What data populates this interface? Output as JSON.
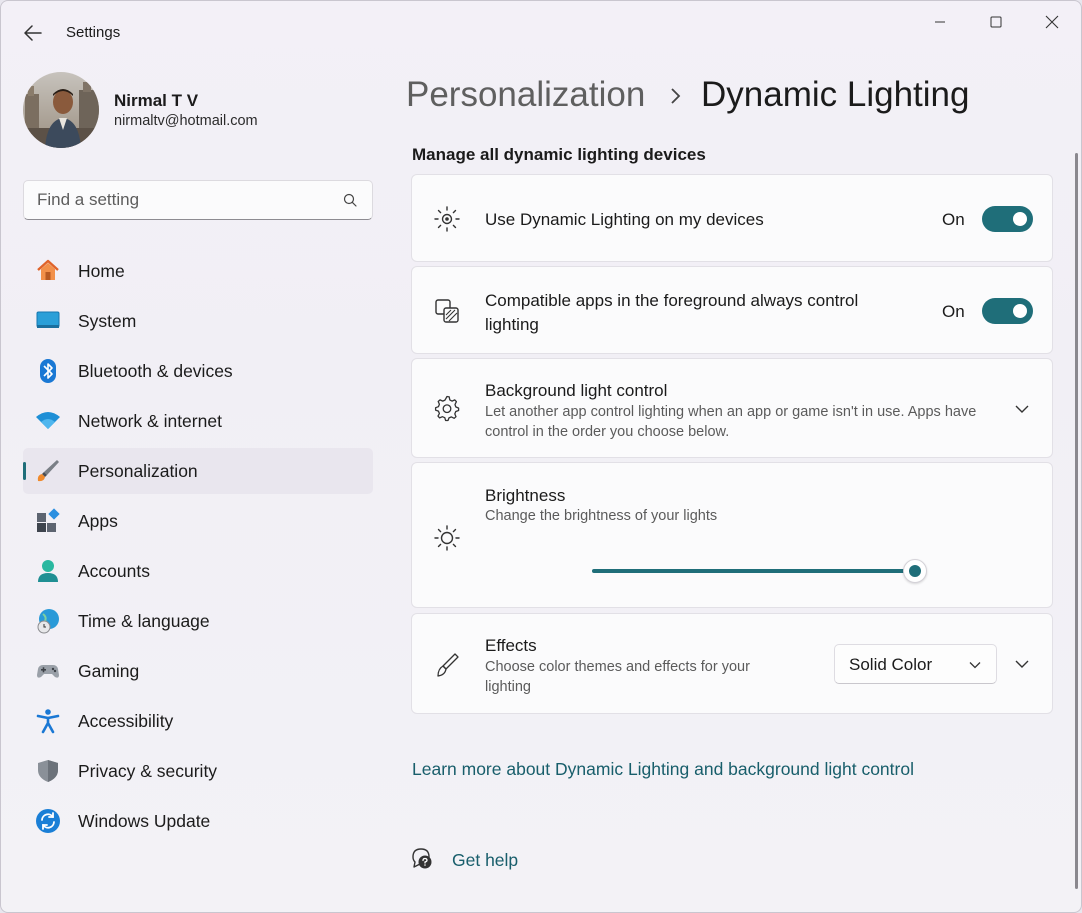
{
  "window": {
    "title": "Settings",
    "back_icon": "arrow-left-icon",
    "controls": [
      "minimize-icon",
      "maximize-icon",
      "close-icon"
    ]
  },
  "profile": {
    "name": "Nirmal T V",
    "email": "nirmaltv@hotmail.com"
  },
  "search": {
    "placeholder": "Find a setting",
    "value": ""
  },
  "sidebar": {
    "items": [
      {
        "label": "Home",
        "icon": "home-icon",
        "active": false
      },
      {
        "label": "System",
        "icon": "system-icon",
        "active": false
      },
      {
        "label": "Bluetooth & devices",
        "icon": "bluetooth-icon",
        "active": false
      },
      {
        "label": "Network & internet",
        "icon": "wifi-icon",
        "active": false
      },
      {
        "label": "Personalization",
        "icon": "paintbrush-icon",
        "active": true
      },
      {
        "label": "Apps",
        "icon": "apps-icon",
        "active": false
      },
      {
        "label": "Accounts",
        "icon": "accounts-icon",
        "active": false
      },
      {
        "label": "Time & language",
        "icon": "globe-clock-icon",
        "active": false
      },
      {
        "label": "Gaming",
        "icon": "gamepad-icon",
        "active": false
      },
      {
        "label": "Accessibility",
        "icon": "accessibility-icon",
        "active": false
      },
      {
        "label": "Privacy & security",
        "icon": "shield-icon",
        "active": false
      },
      {
        "label": "Windows Update",
        "icon": "update-icon",
        "active": false
      }
    ]
  },
  "breadcrumb": {
    "parent": "Personalization",
    "current": "Dynamic Lighting"
  },
  "main": {
    "section_title": "Manage all dynamic lighting devices",
    "use_dynamic_lighting": {
      "title": "Use Dynamic Lighting on my devices",
      "state_label": "On",
      "on": true
    },
    "compatible_apps": {
      "title": "Compatible apps in the foreground always control lighting",
      "state_label": "On",
      "on": true
    },
    "background_control": {
      "title": "Background light control",
      "description": "Let another app control lighting when an app or game isn't in use. Apps have control in the order you choose below."
    },
    "brightness": {
      "title": "Brightness",
      "description": "Change the brightness of your lights",
      "value": 100
    },
    "effects": {
      "title": "Effects",
      "description": "Choose color themes and effects for your lighting",
      "selected": "Solid Color"
    },
    "learn_more": "Learn more about Dynamic Lighting and background light control",
    "get_help": "Get help"
  },
  "colors": {
    "accent": "#1f6e79",
    "link": "#185e6b"
  }
}
